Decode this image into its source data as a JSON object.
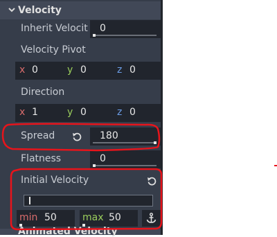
{
  "section": {
    "title": "Velocity"
  },
  "inherit_velocity": {
    "label": "Inherit Velocit",
    "value": "0",
    "fraction": 0.0
  },
  "velocity_pivot": {
    "label": "Velocity Pivot",
    "x_label": "x",
    "x": "0",
    "y_label": "y",
    "y": "0",
    "z_label": "z",
    "z": "0"
  },
  "direction": {
    "label": "Direction",
    "x_label": "x",
    "x": "1",
    "y_label": "y",
    "y": "0",
    "z_label": "z",
    "z": "0"
  },
  "spread": {
    "label": "Spread",
    "value": "180",
    "fraction": 1.0
  },
  "flatness": {
    "label": "Flatness",
    "value": "0",
    "fraction": 0.0
  },
  "initial_velocity": {
    "label": "Initial Velocity",
    "min_label": "min",
    "min": "50",
    "max_label": "max",
    "max": "50"
  },
  "next_section": {
    "title": "Animated Velocity"
  },
  "icons": {
    "reset": "reset-icon",
    "anchor": "anchor-icon",
    "collapse": "chevron-down-icon"
  },
  "colors": {
    "annotation": "#e8141b",
    "panel": "#363d4a",
    "field": "#21252d"
  }
}
